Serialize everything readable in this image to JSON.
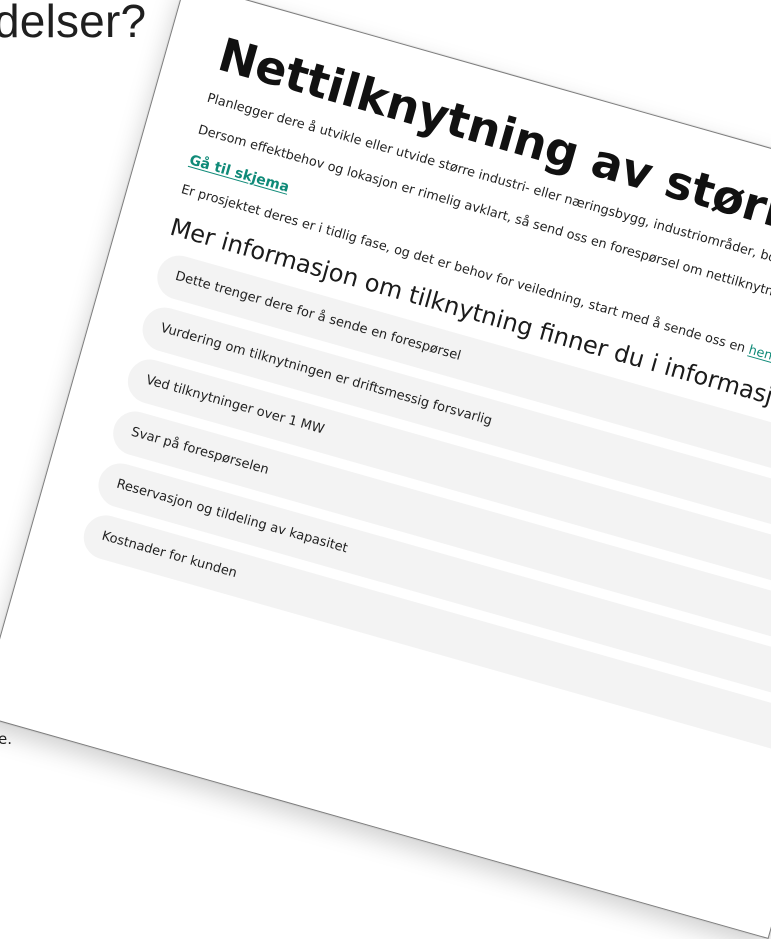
{
  "background": {
    "heading_fragment": "delser?",
    "text_fragment": "e."
  },
  "page": {
    "title": "Nettilknytning av større anlegg",
    "intro": "Planlegger dere å utvikle eller utvide større industri- eller næringsbygg, industriområder, bol kontakte oss.",
    "para_effect": "Dersom effektbehov og lokasjon er rimelig avklart, så send oss en forespørsel om nettilknytning",
    "link_form": "Gå til skjema",
    "para_early_prefix": "Er prosjektet deres er i tidlig fase, og det er behov for veiledning, start med å sende oss en ",
    "para_early_link": "henvend",
    "section_heading": "Mer informasjon om tilknytning finner du i informasjonsbo"
  },
  "accordion": {
    "items": [
      {
        "label": "Dette trenger dere for å sende en forespørsel"
      },
      {
        "label": "Vurdering om tilknytningen er driftsmessig forsvarlig"
      },
      {
        "label": "Ved tilknytninger over 1 MW"
      },
      {
        "label": "Svar på forespørselen"
      },
      {
        "label": "Reservasjon og tildeling av kapasitet"
      },
      {
        "label": "Kostnader for kunden"
      }
    ]
  },
  "colors": {
    "accent": "#0f8a78",
    "accordion_bg": "#f3f3f3",
    "text": "#1b1b1b",
    "border": "#7d7d7d"
  }
}
